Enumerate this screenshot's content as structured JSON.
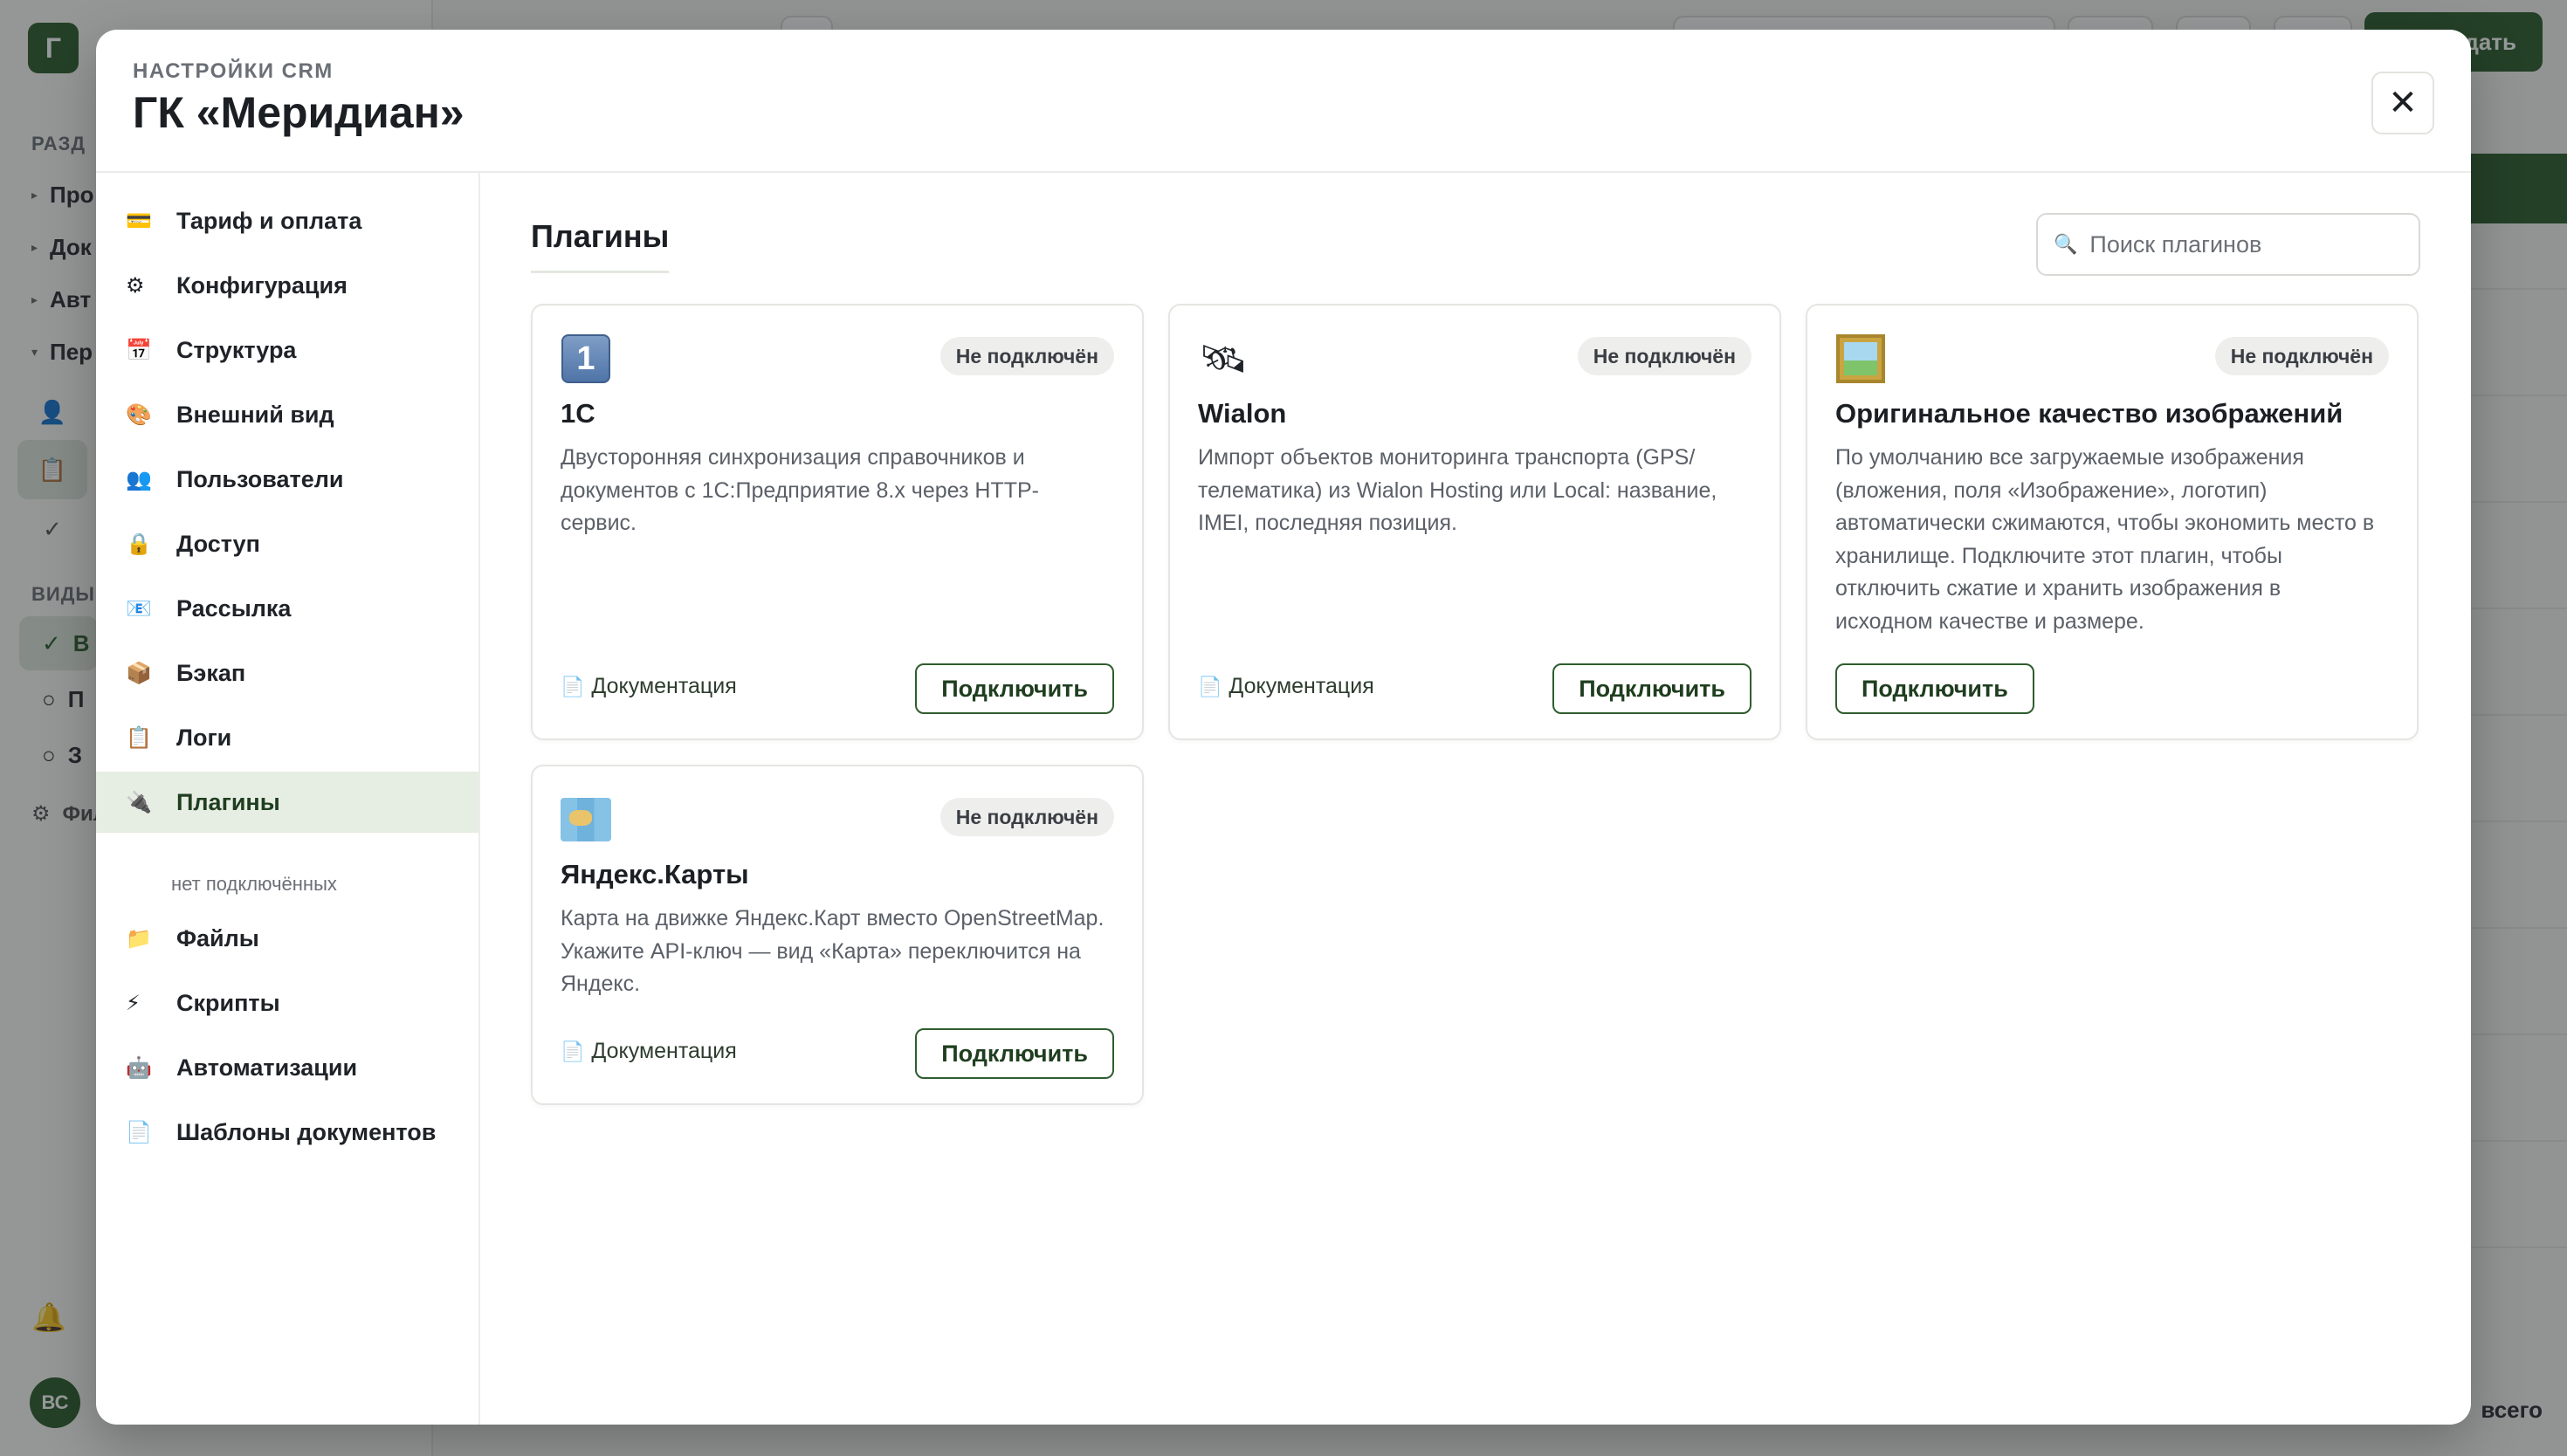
{
  "background": {
    "logo_letter": "Г",
    "sections_label": "РАЗД",
    "views_label": "ВИДЫ",
    "nav_items": [
      "Про",
      "Док",
      "Авт",
      "Пер"
    ],
    "view_items": [
      "В",
      "П",
      "З"
    ],
    "filter_label": "Фил",
    "create_button": "дать",
    "avatar_initials": "ВС",
    "footer_total": "всего"
  },
  "modal": {
    "kicker": "НАСТРОЙКИ CRM",
    "title": "ГК «Меридиан»",
    "close_label": "✕"
  },
  "menu": {
    "items": [
      {
        "label": "Тариф и оплата",
        "icon": "credit-card-icon",
        "glyph": "💳"
      },
      {
        "label": "Конфигурация",
        "icon": "gear-icon",
        "glyph": "⚙"
      },
      {
        "label": "Структура",
        "icon": "calendar-icon",
        "glyph": "📅"
      },
      {
        "label": "Внешний вид",
        "icon": "palette-icon",
        "glyph": "🎨"
      },
      {
        "label": "Пользователи",
        "icon": "users-icon",
        "glyph": "👥"
      },
      {
        "label": "Доступ",
        "icon": "lock-icon",
        "glyph": "🔒"
      },
      {
        "label": "Рассылка",
        "icon": "mail-icon",
        "glyph": "📧"
      },
      {
        "label": "Бэкап",
        "icon": "package-icon",
        "glyph": "📦"
      },
      {
        "label": "Логи",
        "icon": "log-icon",
        "glyph": "📋"
      },
      {
        "label": "Плагины",
        "icon": "plug-icon",
        "glyph": "🔌"
      },
      {
        "label": "Файлы",
        "icon": "folder-icon",
        "glyph": "📁"
      },
      {
        "label": "Скрипты",
        "icon": "lightning-icon",
        "glyph": "⚡"
      },
      {
        "label": "Автоматизации",
        "icon": "robot-icon",
        "glyph": "🤖"
      },
      {
        "label": "Шаблоны документов",
        "icon": "document-icon",
        "glyph": "📄"
      }
    ],
    "plugins_sub": "нет подключённых"
  },
  "content": {
    "title": "Плагины",
    "search_placeholder": "Поиск плагинов",
    "search_value": ""
  },
  "plugins": [
    {
      "name": "1С",
      "status": "Не подключён",
      "icon": "1c-icon",
      "icon_glyph": "1",
      "description": "Двусторонняя синхронизация справочников и документов с 1С:Предприятие 8.x через HTTP-сервис.",
      "doc_label": "Документация",
      "connect_label": "Подключить"
    },
    {
      "name": "Wialon",
      "status": "Не подключён",
      "icon": "satellite-icon",
      "icon_glyph": "🛰",
      "description": "Импорт объектов мониторинга транспорта (GPS/телематика) из Wialon Hosting или Local: название, IMEI, последняя позиция.",
      "doc_label": "Документация",
      "connect_label": "Подключить"
    },
    {
      "name": "Оригинальное качество изображений",
      "status": "Не подключён",
      "icon": "framed-picture-icon",
      "description": "По умолчанию все загружаемые изображения (вложения, поля «Изображение», логотип) автоматически сжимаются, чтобы экономить место в хранилище. Подключите этот плагин, чтобы отключить сжатие и хранить изображения в исходном качестве и размере.",
      "connect_label": "Подключить"
    },
    {
      "name": "Яндекс.Карты",
      "status": "Не подключён",
      "icon": "map-icon",
      "description": "Карта на движке Яндекс.Карт вместо OpenStreetMap. Укажите API-ключ — вид «Карта» переключится на Яндекс.",
      "doc_label": "Документация",
      "connect_label": "Подключить"
    }
  ],
  "colors": {
    "accent": "#2f5d2f",
    "active_menu_bg": "#e6ede3",
    "badge_bg": "#eeeeec"
  }
}
